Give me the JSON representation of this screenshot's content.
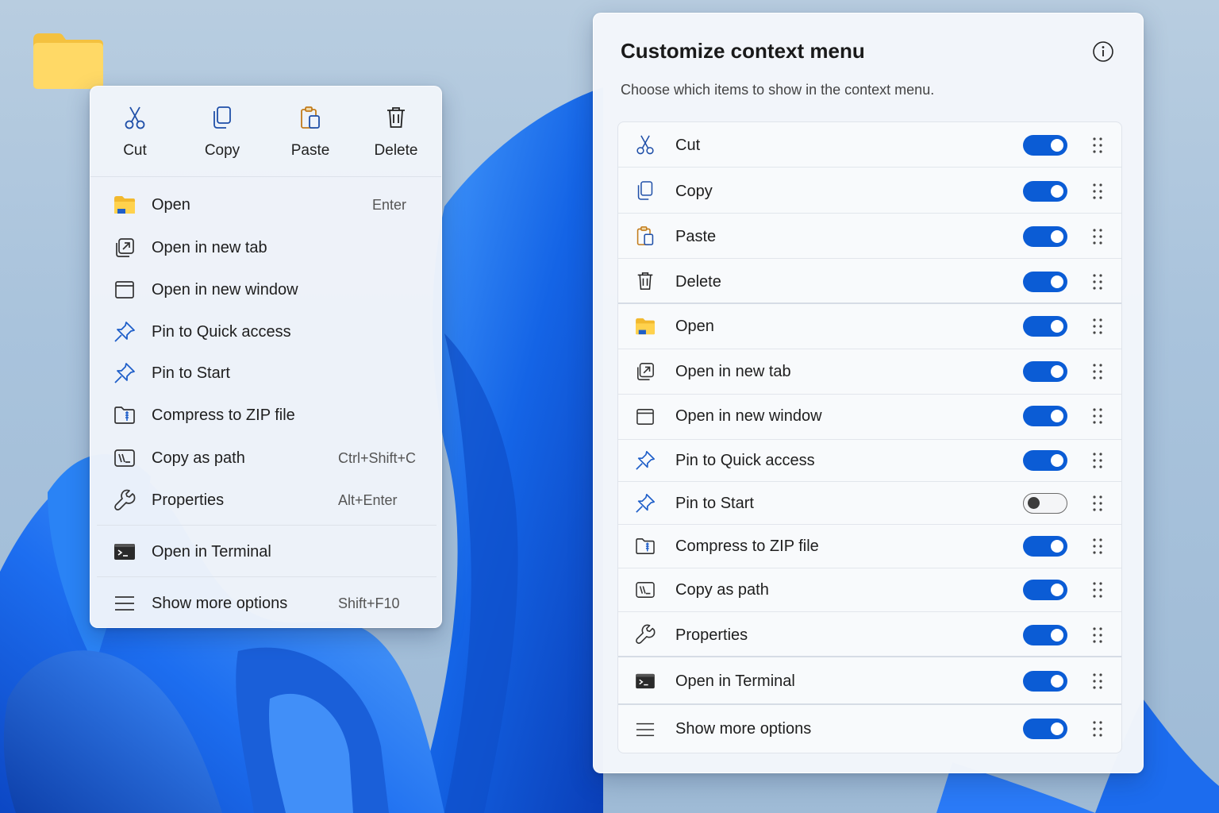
{
  "context_menu": {
    "quick_actions": [
      {
        "label": "Cut",
        "icon": "scissors-icon"
      },
      {
        "label": "Copy",
        "icon": "copy-icon"
      },
      {
        "label": "Paste",
        "icon": "paste-icon"
      },
      {
        "label": "Delete",
        "icon": "trash-icon"
      }
    ],
    "items": [
      {
        "label": "Open",
        "shortcut": "Enter",
        "icon": "folder-icon"
      },
      {
        "label": "Open in new tab",
        "shortcut": "",
        "icon": "new-tab-icon"
      },
      {
        "label": "Open in new window",
        "shortcut": "",
        "icon": "window-icon"
      },
      {
        "label": "Pin to Quick access",
        "shortcut": "",
        "icon": "pin-icon"
      },
      {
        "label": "Pin to Start",
        "shortcut": "",
        "icon": "pin-icon"
      },
      {
        "label": "Compress to ZIP file",
        "shortcut": "",
        "icon": "zip-folder-icon"
      },
      {
        "label": "Copy as path",
        "shortcut": "Ctrl+Shift+C",
        "icon": "copy-path-icon"
      },
      {
        "label": "Properties",
        "shortcut": "Alt+Enter",
        "icon": "wrench-icon"
      },
      {
        "label": "Open in Terminal",
        "shortcut": "",
        "icon": "terminal-icon"
      },
      {
        "label": "Show more options",
        "shortcut": "Shift+F10",
        "icon": "menu-icon"
      }
    ]
  },
  "customize_panel": {
    "title": "Customize context menu",
    "subtitle": "Choose which items to show in the context menu.",
    "info_icon": "info-icon",
    "items": [
      {
        "label": "Cut",
        "enabled": true,
        "icon": "scissors-icon"
      },
      {
        "label": "Copy",
        "enabled": true,
        "icon": "copy-icon"
      },
      {
        "label": "Paste",
        "enabled": true,
        "icon": "paste-icon"
      },
      {
        "label": "Delete",
        "enabled": true,
        "icon": "trash-icon"
      },
      {
        "label": "Open",
        "enabled": true,
        "icon": "folder-icon"
      },
      {
        "label": "Open in new tab",
        "enabled": true,
        "icon": "new-tab-icon"
      },
      {
        "label": "Open in new window",
        "enabled": true,
        "icon": "window-icon"
      },
      {
        "label": "Pin to Quick access",
        "enabled": true,
        "icon": "pin-icon"
      },
      {
        "label": "Pin to Start",
        "enabled": false,
        "icon": "pin-icon"
      },
      {
        "label": "Compress to ZIP file",
        "enabled": true,
        "icon": "zip-folder-icon"
      },
      {
        "label": "Copy as path",
        "enabled": true,
        "icon": "copy-path-icon"
      },
      {
        "label": "Properties",
        "enabled": true,
        "icon": "wrench-icon"
      },
      {
        "label": "Open in Terminal",
        "enabled": true,
        "icon": "terminal-icon"
      },
      {
        "label": "Show more options",
        "enabled": true,
        "icon": "menu-icon"
      }
    ]
  },
  "colors": {
    "accent": "#0b5cd5",
    "folder": "#f7c948",
    "wallpaper_blue": "#1a6ff0"
  }
}
